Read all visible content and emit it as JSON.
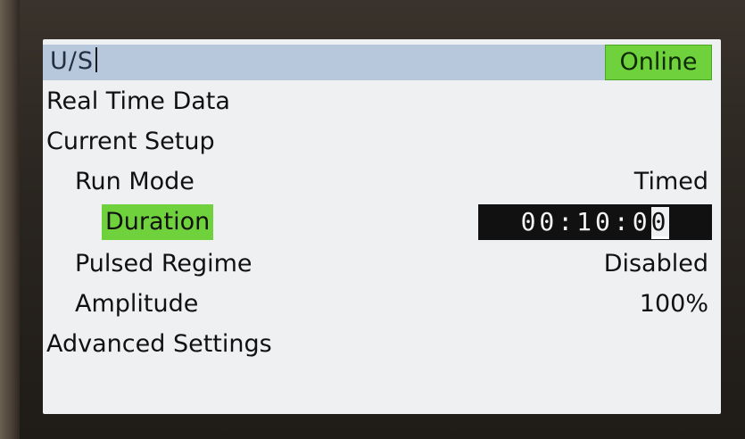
{
  "header": {
    "title": "U/S",
    "status": "Online"
  },
  "menu": {
    "real_time_data": "Real Time Data",
    "current_setup": "Current Setup",
    "run_mode": {
      "label": "Run Mode",
      "value": "Timed"
    },
    "duration": {
      "label": "Duration",
      "value_prefix": "00:10:0",
      "value_edit_digit": "0"
    },
    "pulsed_regime": {
      "label": "Pulsed Regime",
      "value": "Disabled"
    },
    "amplitude": {
      "label": "Amplitude",
      "value": "100%"
    },
    "advanced_settings": "Advanced Settings"
  },
  "colors": {
    "header_bg": "#b7c7dc",
    "highlight_green": "#6fd23c",
    "screen_bg": "#eef0f2",
    "edit_box_bg": "#111111"
  }
}
